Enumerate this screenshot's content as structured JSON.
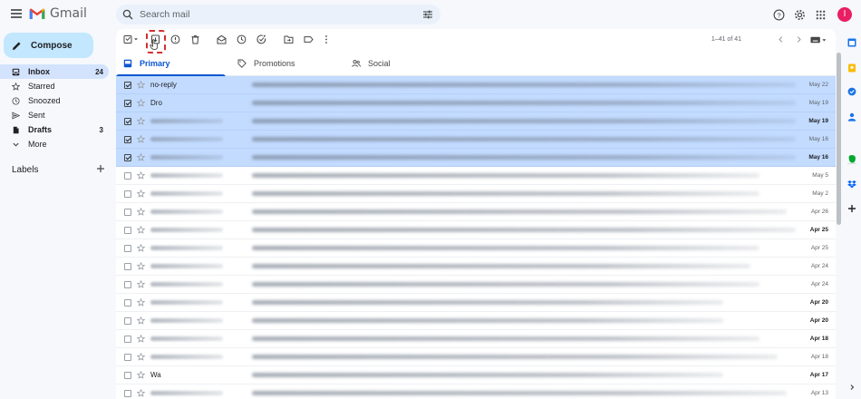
{
  "app": {
    "name": "Gmail",
    "avatar_letter": "I"
  },
  "search": {
    "placeholder": "Search mail"
  },
  "compose": {
    "label": "Compose"
  },
  "nav": [
    {
      "label": "Inbox",
      "count": "24",
      "icon": "inbox-icon"
    },
    {
      "label": "Starred",
      "count": "",
      "icon": "star-icon"
    },
    {
      "label": "Snoozed",
      "count": "",
      "icon": "clock-icon"
    },
    {
      "label": "Sent",
      "count": "",
      "icon": "send-icon"
    },
    {
      "label": "Drafts",
      "count": "3",
      "icon": "draft-icon"
    },
    {
      "label": "More",
      "count": "",
      "icon": "chevron-down-icon"
    }
  ],
  "labels": {
    "title": "Labels"
  },
  "pager": {
    "range": "1–41 of 41"
  },
  "tabs": [
    {
      "label": "Primary",
      "icon": "inbox-icon"
    },
    {
      "label": "Promotions",
      "icon": "tag-icon"
    },
    {
      "label": "Social",
      "icon": "people-icon"
    }
  ],
  "emails": [
    {
      "sender": "no-reply",
      "date": "May 22",
      "selected": true,
      "unread": false
    },
    {
      "sender": "Dro",
      "date": "May 19",
      "selected": true,
      "unread": false
    },
    {
      "sender": "",
      "date": "May 19",
      "selected": true,
      "unread": true
    },
    {
      "sender": "",
      "date": "May 16",
      "selected": true,
      "unread": false
    },
    {
      "sender": "",
      "date": "May 16",
      "selected": true,
      "unread": true
    },
    {
      "sender": "",
      "date": "May 5",
      "selected": false,
      "unread": false
    },
    {
      "sender": "",
      "date": "May 2",
      "selected": false,
      "unread": false
    },
    {
      "sender": "",
      "date": "Apr 26",
      "selected": false,
      "unread": false
    },
    {
      "sender": "",
      "date": "Apr 25",
      "selected": false,
      "unread": true
    },
    {
      "sender": "",
      "date": "Apr 25",
      "selected": false,
      "unread": false
    },
    {
      "sender": "",
      "date": "Apr 24",
      "selected": false,
      "unread": false
    },
    {
      "sender": "",
      "date": "Apr 24",
      "selected": false,
      "unread": false
    },
    {
      "sender": "",
      "date": "Apr 20",
      "selected": false,
      "unread": true
    },
    {
      "sender": "",
      "date": "Apr 20",
      "selected": false,
      "unread": true
    },
    {
      "sender": "",
      "date": "Apr 18",
      "selected": false,
      "unread": true
    },
    {
      "sender": "",
      "date": "Apr 18",
      "selected": false,
      "unread": false
    },
    {
      "sender": "Wa",
      "date": "Apr 17",
      "selected": false,
      "unread": true
    },
    {
      "sender": "",
      "date": "Apr 13",
      "selected": false,
      "unread": false
    }
  ],
  "colors": {
    "accent": "#0b57d0",
    "compose_bg": "#c2e7ff",
    "selected_row": "#c2dbff",
    "avatar_bg": "#e91e63",
    "highlight": "#d32f2f"
  }
}
